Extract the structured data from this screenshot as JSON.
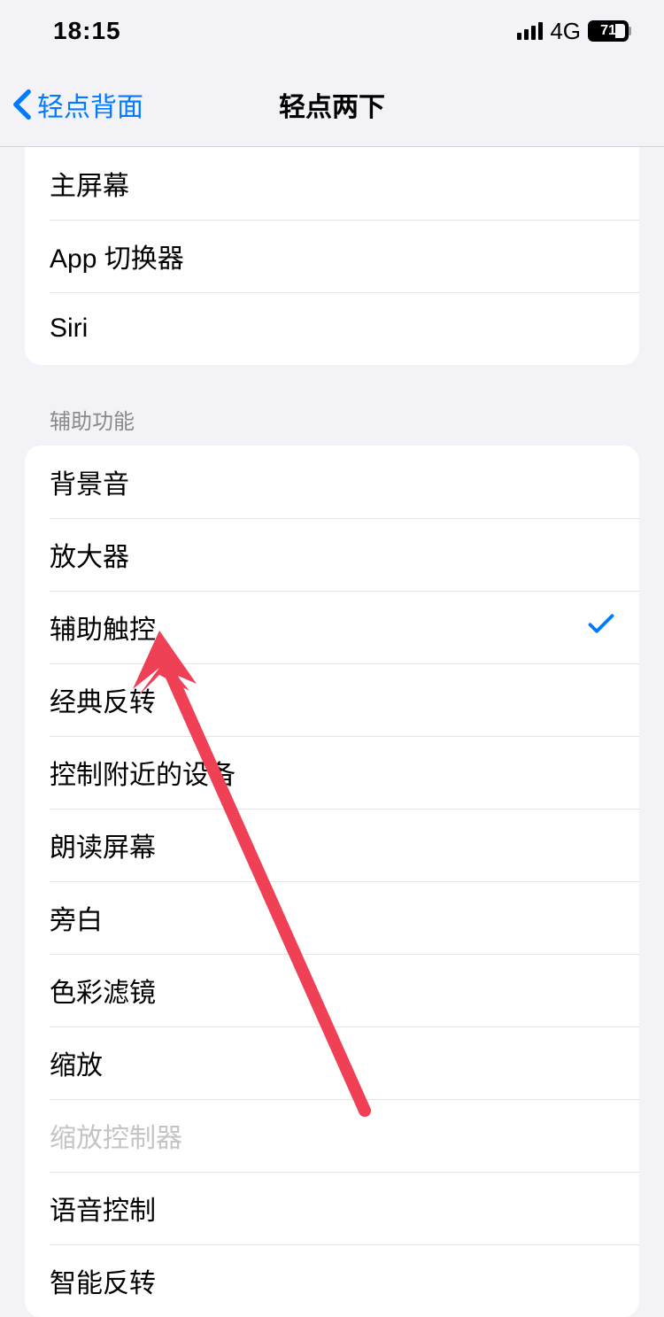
{
  "status": {
    "time": "18:15",
    "network": "4G",
    "battery": "71"
  },
  "nav": {
    "back_label": "轻点背面",
    "title": "轻点两下"
  },
  "group1": {
    "items": [
      {
        "label": "主屏幕"
      },
      {
        "label": "App 切换器"
      },
      {
        "label": "Siri"
      }
    ]
  },
  "section2": {
    "header": "辅助功能",
    "items": [
      {
        "label": "背景音",
        "selected": false,
        "disabled": false
      },
      {
        "label": "放大器",
        "selected": false,
        "disabled": false
      },
      {
        "label": "辅助触控",
        "selected": true,
        "disabled": false
      },
      {
        "label": "经典反转",
        "selected": false,
        "disabled": false
      },
      {
        "label": "控制附近的设备",
        "selected": false,
        "disabled": false
      },
      {
        "label": "朗读屏幕",
        "selected": false,
        "disabled": false
      },
      {
        "label": "旁白",
        "selected": false,
        "disabled": false
      },
      {
        "label": "色彩滤镜",
        "selected": false,
        "disabled": false
      },
      {
        "label": "缩放",
        "selected": false,
        "disabled": false
      },
      {
        "label": "缩放控制器",
        "selected": false,
        "disabled": true
      },
      {
        "label": "语音控制",
        "selected": false,
        "disabled": false
      },
      {
        "label": "智能反转",
        "selected": false,
        "disabled": false
      }
    ]
  }
}
